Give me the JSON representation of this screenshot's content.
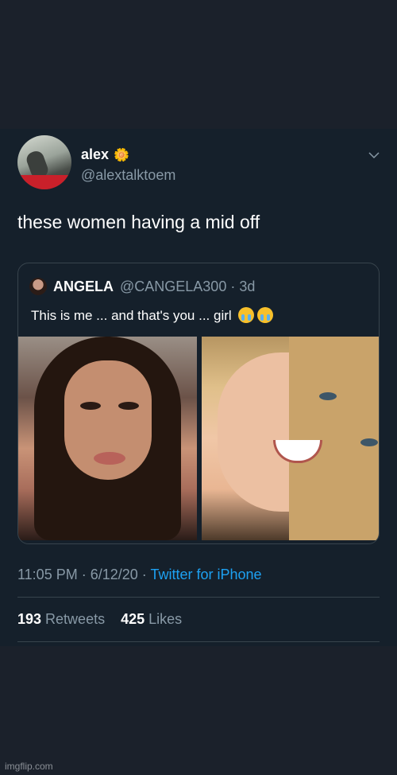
{
  "tweet": {
    "name": "alex",
    "name_emoji": "🌼",
    "handle": "@alextalktoem",
    "text": "these women having a mid off",
    "timestamp": "11:05 PM · 6/12/20 · ",
    "source": "Twitter for iPhone",
    "retweets_count": "193",
    "retweets_label": " Retweets",
    "likes_count": "425",
    "likes_label": " Likes"
  },
  "quote": {
    "name": "ANGELA",
    "handle": "@CANGELA300 · 3d",
    "text": "This is me ... and that's you ... girl"
  },
  "watermark": "imgflip.com",
  "icons": {
    "caret": "chevron-down-icon",
    "emoji": "loudly-crying-face-icon"
  },
  "colors": {
    "background": "#15202b",
    "accent": "#1da1f2",
    "muted": "#8899a6"
  }
}
